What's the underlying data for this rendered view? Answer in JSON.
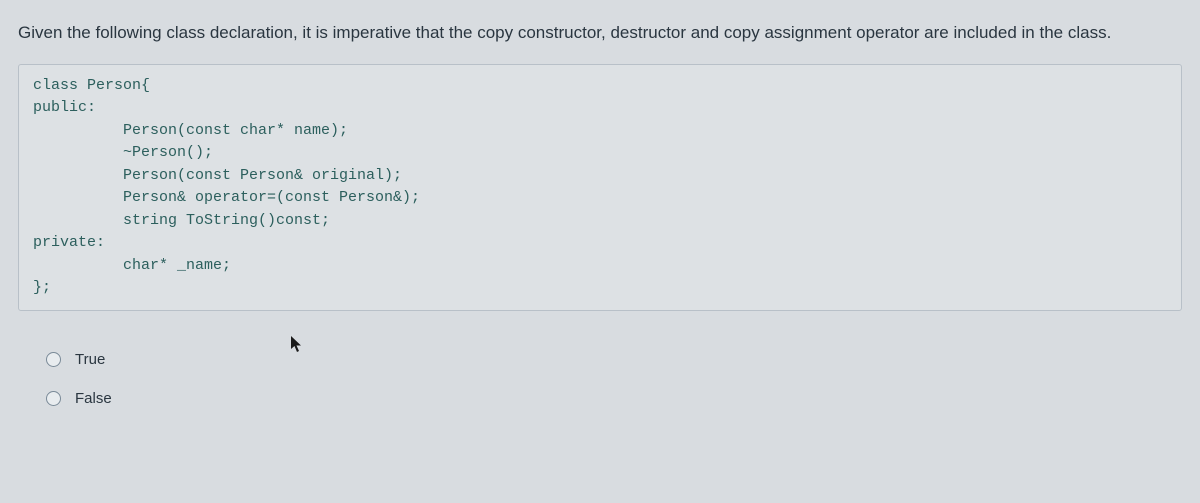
{
  "question": {
    "prompt": "Given the following class declaration, it is imperative that the copy constructor, destructor and copy assignment operator are included in the class."
  },
  "code": {
    "l0": "class Person{",
    "l1": "public:",
    "l2": "          Person(const char* name);",
    "l3": "          ~Person();",
    "l4": "          Person(const Person& original);",
    "l5": "          Person& operator=(const Person&);",
    "l6": "          string ToString()const;",
    "l7": "private:",
    "l8": "          char* _name;",
    "l9": "};"
  },
  "options": {
    "opt0": "True",
    "opt1": "False"
  }
}
